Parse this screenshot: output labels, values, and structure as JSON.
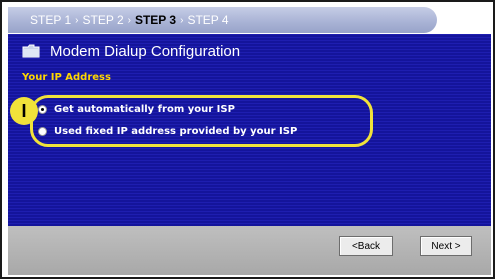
{
  "steps": [
    {
      "label": "STEP 1",
      "active": false
    },
    {
      "label": "STEP 2",
      "active": false
    },
    {
      "label": "STEP 3",
      "active": true
    },
    {
      "label": "STEP 4",
      "active": false
    }
  ],
  "step_separator": "›",
  "header": {
    "title": "Modem Dialup Configuration",
    "icon": "folder-icon"
  },
  "section": {
    "label": "Your IP Address"
  },
  "options": [
    {
      "label": "Get automatically from your ISP",
      "selected": true
    },
    {
      "label": "Used fixed IP address provided by your ISP",
      "selected": false
    }
  ],
  "callout": {
    "label": "I"
  },
  "buttons": {
    "back": "<Back",
    "next": "Next >"
  },
  "colors": {
    "panel_blue": "#14149b",
    "highlight_yellow": "#f1e23a",
    "section_label": "#ffd700",
    "steps_bar": "#aab4d6",
    "footer_gray": "#b3b3b3"
  }
}
